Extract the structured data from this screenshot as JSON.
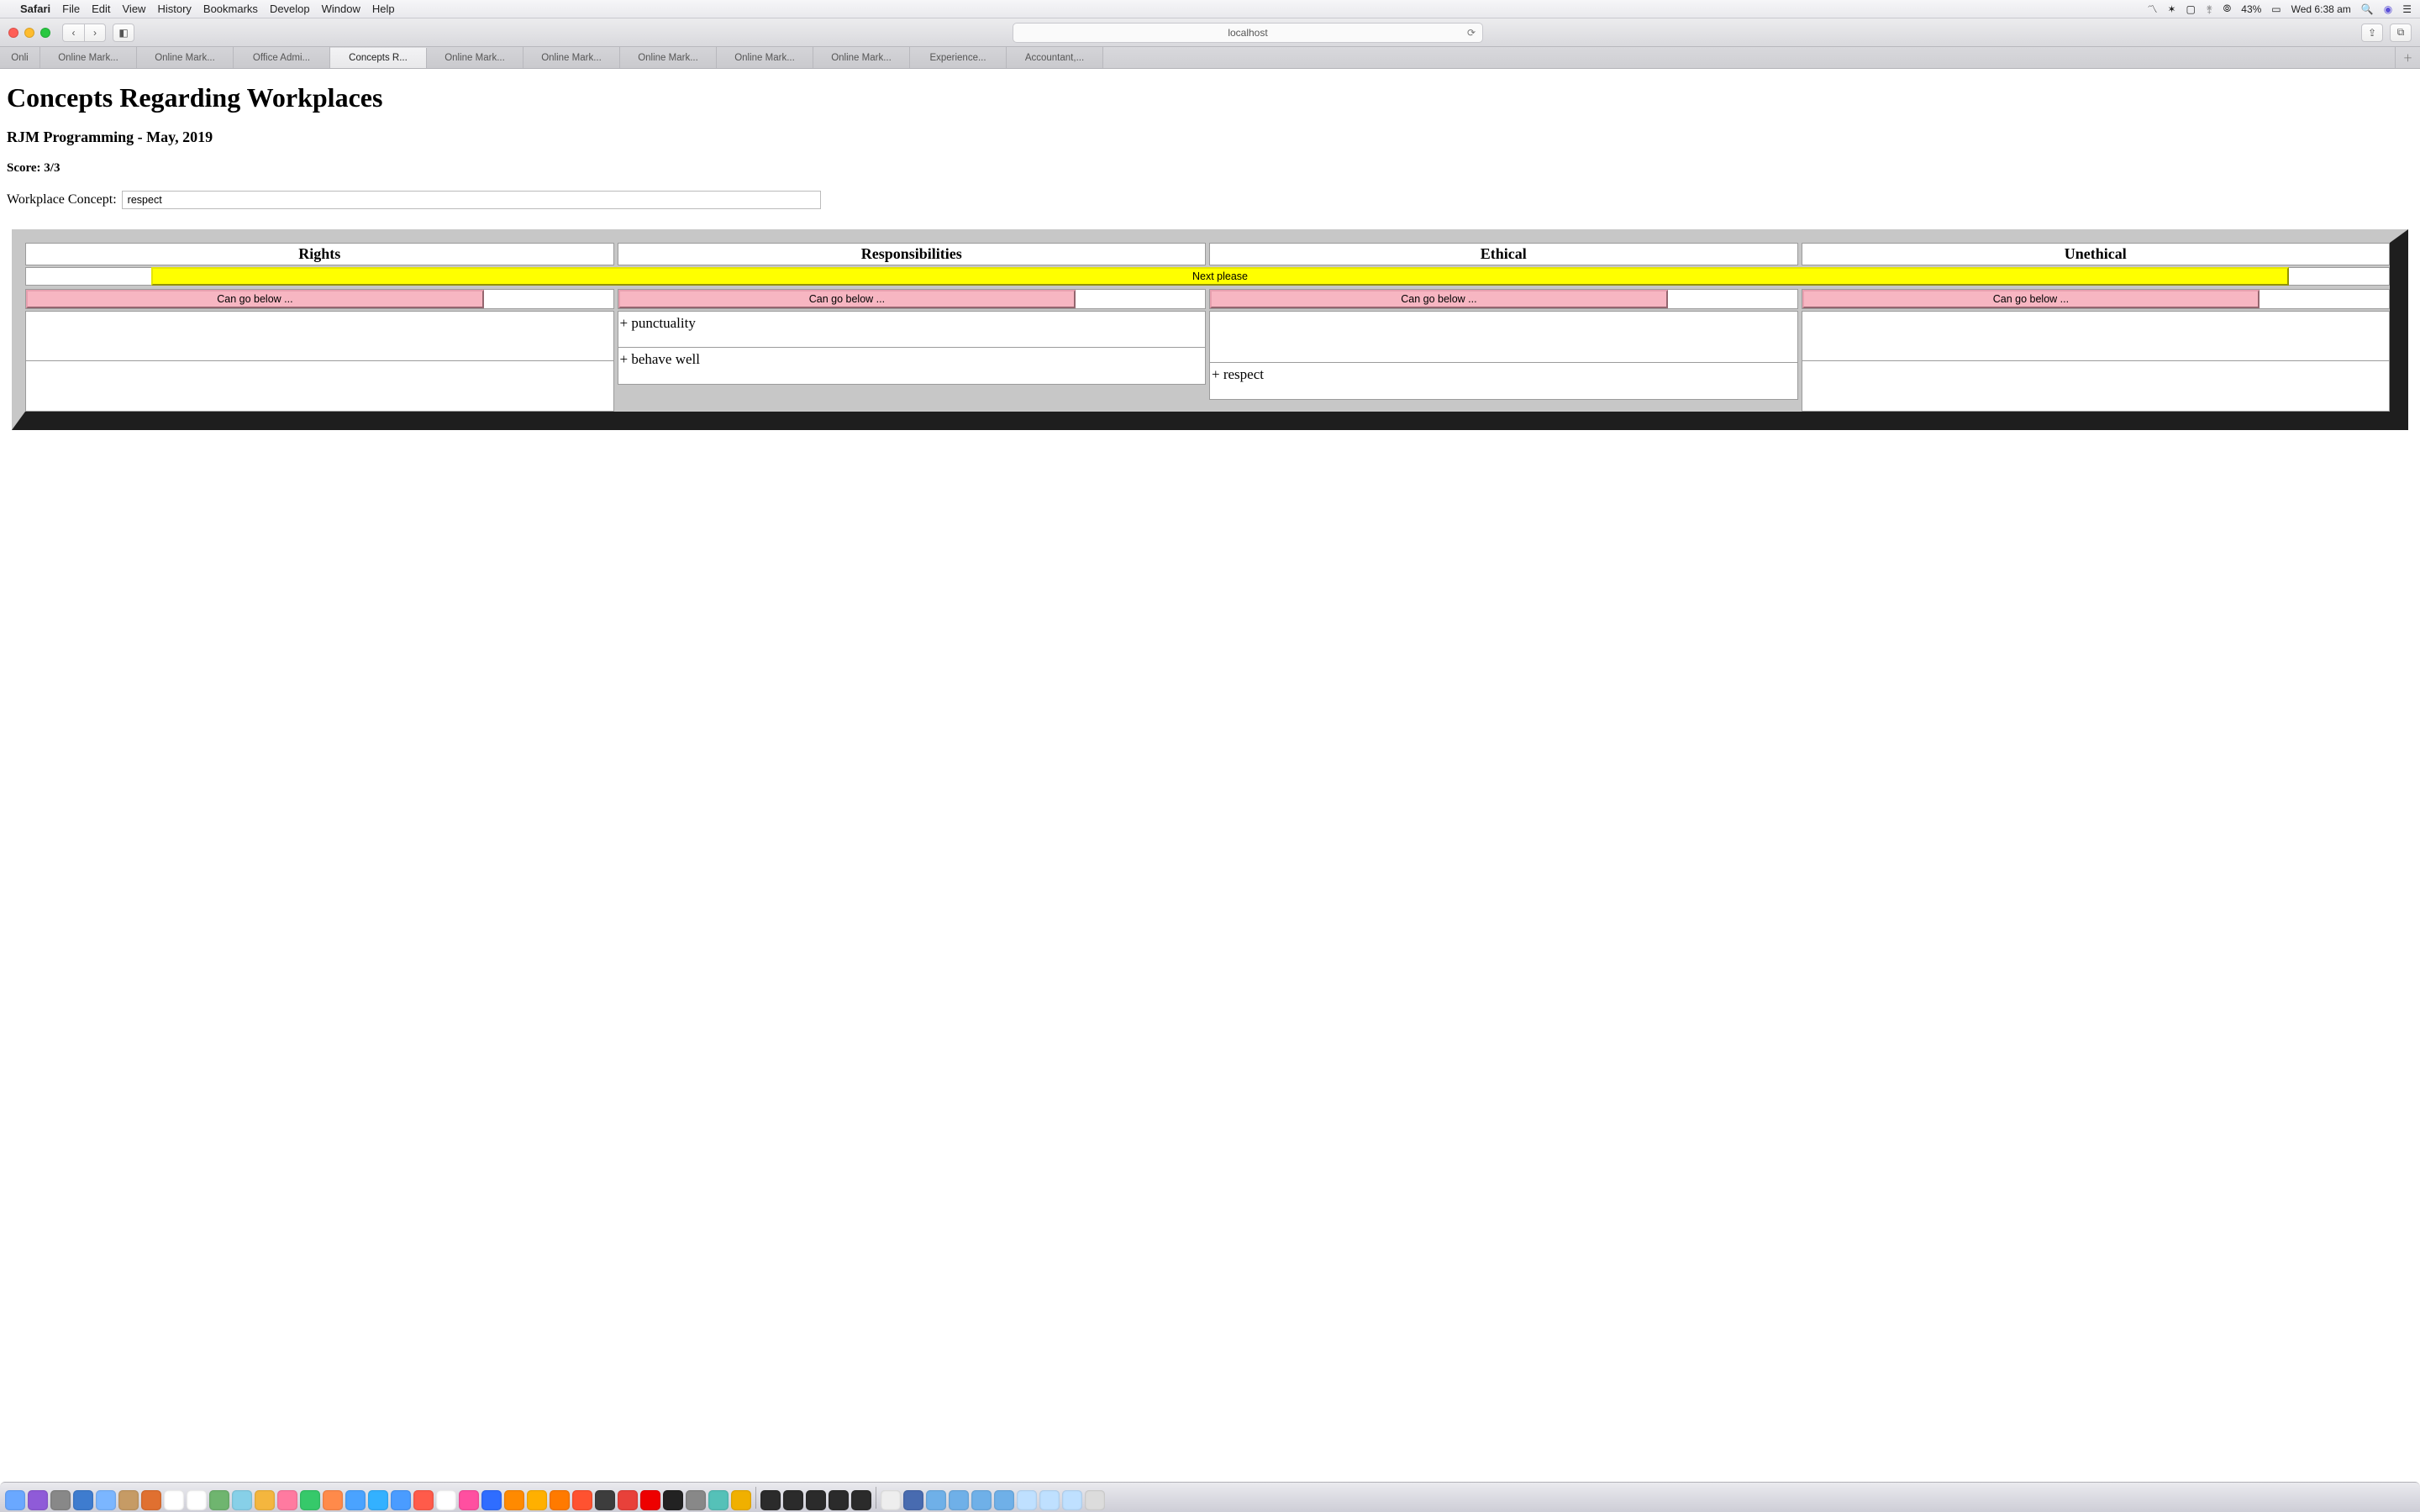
{
  "menubar": {
    "app": "Safari",
    "items": [
      "File",
      "Edit",
      "View",
      "History",
      "Bookmarks",
      "Develop",
      "Window",
      "Help"
    ],
    "battery": "43%",
    "clock": "Wed 6:38 am"
  },
  "safari": {
    "address": "localhost",
    "tabs": [
      "Onli",
      "Online Mark...",
      "Online Mark...",
      "Office Admi...",
      "Concepts R...",
      "Online Mark...",
      "Online Mark...",
      "Online Mark...",
      "Online Mark...",
      "Online Mark...",
      "Experience...",
      "Accountant,..."
    ],
    "active_tab_index": 4
  },
  "page": {
    "title": "Concepts Regarding Workplaces",
    "subtitle": "RJM Programming - May, 2019",
    "score_label": "Score: 3/3",
    "concept_label": "Workplace Concept:",
    "concept_value": "respect",
    "columns": [
      "Rights",
      "Responsibilities",
      "Ethical",
      "Unethical"
    ],
    "next_label": "Next please",
    "zone_label": "Can go below ...",
    "entries": {
      "rights": [
        "",
        ""
      ],
      "responsibilities": [
        "+ punctuality",
        "+ behave well"
      ],
      "ethical": [
        "",
        "+ respect"
      ],
      "unethical": [
        "",
        ""
      ]
    }
  },
  "dock": {
    "colors": [
      "#6aa8ff",
      "#8f5bd8",
      "#888",
      "#3e7ccf",
      "#7bb6ff",
      "#c69b65",
      "#e07030",
      "#fff",
      "#fff",
      "#6fb56f",
      "#87d0e8",
      "#f4b63e",
      "#ff7aa0",
      "#36c96a",
      "#ff8a4a",
      "#4aa3ff",
      "#33b1ff",
      "#4a9cff",
      "#ff5b4a",
      "#fff",
      "#ff4fa0",
      "#2f6dff",
      "#ff8a00",
      "#ffb000",
      "#ff7a00",
      "#ff5230",
      "#3d3d3d",
      "#e8413a",
      "#ee0000",
      "#222",
      "#888",
      "#55c1b8",
      "#f0b000",
      "#2b2b2b",
      "#2b2b2b",
      "#2b2b2b",
      "#2b2b2b",
      "#2b2b2b",
      "#eee",
      "#486bb0",
      "#6fb0e8",
      "#6fb0e8",
      "#6fb0e8",
      "#6fb0e8",
      "#bfe0ff",
      "#bfe0ff",
      "#bfe0ff",
      "#dcdcdc"
    ]
  }
}
